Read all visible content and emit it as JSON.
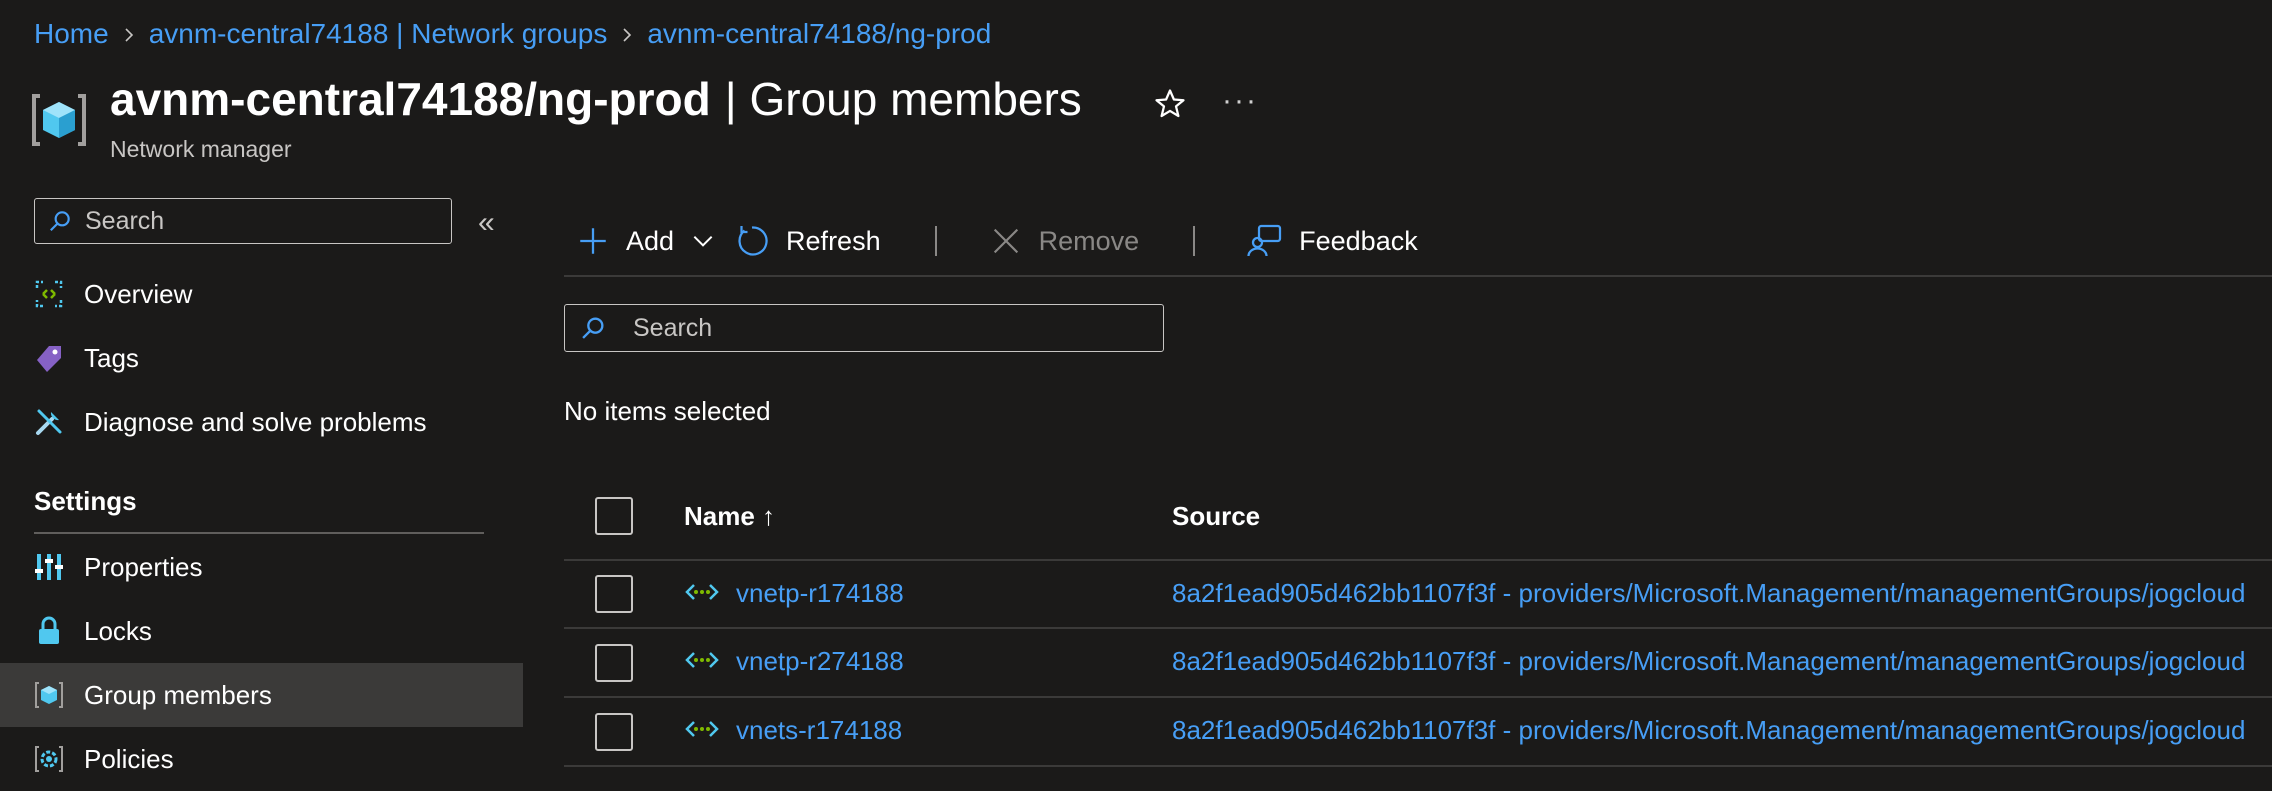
{
  "breadcrumb": {
    "items": [
      "Home",
      "avnm-central74188 | Network groups",
      "avnm-central74188/ng-prod"
    ]
  },
  "header": {
    "title_bold": "avnm-central74188/ng-prod",
    "title_rest": "| Group members",
    "subtitle": "Network manager",
    "favorite_icon": "star-icon",
    "more_icon": "more-icon"
  },
  "sidebar": {
    "search_placeholder": "Search",
    "collapse_icon": "double-chevron-left-icon",
    "items": [
      {
        "label": "Overview",
        "icon": "overview-icon"
      },
      {
        "label": "Tags",
        "icon": "tag-icon"
      },
      {
        "label": "Diagnose and solve problems",
        "icon": "wrench-icon"
      }
    ],
    "section_settings": "Settings",
    "settings_items": [
      {
        "label": "Properties",
        "icon": "properties-icon"
      },
      {
        "label": "Locks",
        "icon": "lock-icon"
      },
      {
        "label": "Group members",
        "icon": "group-members-icon",
        "active": true
      },
      {
        "label": "Policies",
        "icon": "policies-icon"
      }
    ]
  },
  "toolbar": {
    "add_label": "Add",
    "refresh_label": "Refresh",
    "remove_label": "Remove",
    "feedback_label": "Feedback"
  },
  "main": {
    "search_placeholder": "Search",
    "selection_status": "No items selected"
  },
  "table": {
    "columns": [
      "Name ↑",
      "Source"
    ],
    "rows": [
      {
        "name": "vnetp-r174188",
        "source": "8a2f1ead905d462bb1107f3f - providers/Microsoft.Management/managementGroups/jogcloud"
      },
      {
        "name": "vnetp-r274188",
        "source": "8a2f1ead905d462bb1107f3f - providers/Microsoft.Management/managementGroups/jogcloud"
      },
      {
        "name": "vnets-r174188",
        "source": "8a2f1ead905d462bb1107f3f - providers/Microsoft.Management/managementGroups/jogcloud"
      }
    ]
  },
  "colors": {
    "accent": "#479ef5",
    "background": "#1b1a19",
    "active_nav": "#3b3a39"
  }
}
